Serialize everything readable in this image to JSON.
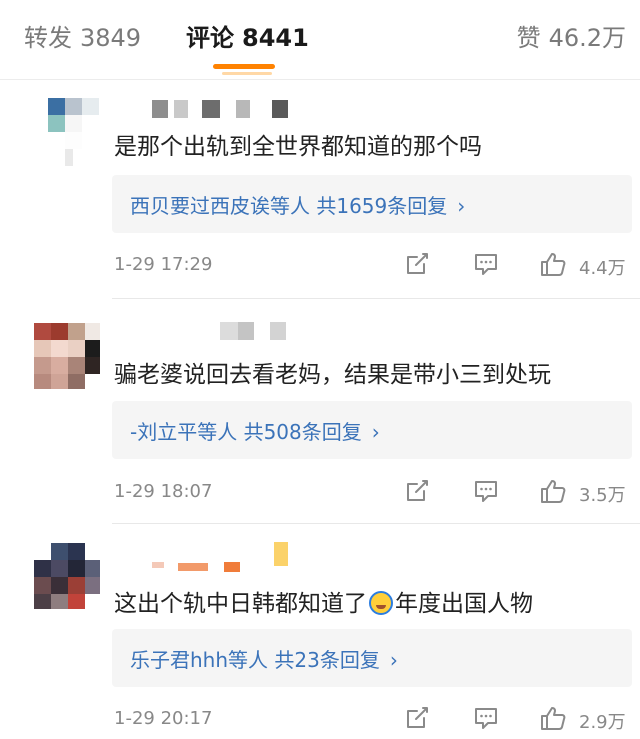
{
  "tabs": {
    "forward": {
      "label": "转发",
      "count": "3849"
    },
    "comment": {
      "label": "评论",
      "count": "8441"
    },
    "like": {
      "label": "赞",
      "count": "46.2万"
    }
  },
  "comments": [
    {
      "text": "是那个出轨到全世界都知道的那个吗",
      "reply": {
        "label": "西贝要过西皮诶等人  共1659条回复",
        "arrow": "›"
      },
      "time": "1-29 17:29",
      "likes": "4.4万"
    },
    {
      "text": "骗老婆说回去看老妈，结果是带小三到处玩",
      "reply": {
        "label": "-刘立平等人  共508条回复",
        "arrow": "›"
      },
      "time": "1-29 18:07",
      "likes": "3.5万"
    },
    {
      "text_before": "这出个轨中日韩都知道了",
      "text_after": "年度出国人物",
      "reply": {
        "label": "乐子君hhh等人  共23条回复",
        "arrow": "›"
      },
      "time": "1-29 20:17",
      "likes": "2.9万"
    }
  ],
  "icons": {
    "share": "share-icon",
    "comment": "comment-icon",
    "like": "thumbs-up-icon",
    "emoji": "laughing-crying-emoji-icon"
  },
  "colors": {
    "accent": "#ff8200",
    "link": "#3b73b9",
    "muted": "#888888",
    "reply_bg": "#f5f5f5"
  }
}
